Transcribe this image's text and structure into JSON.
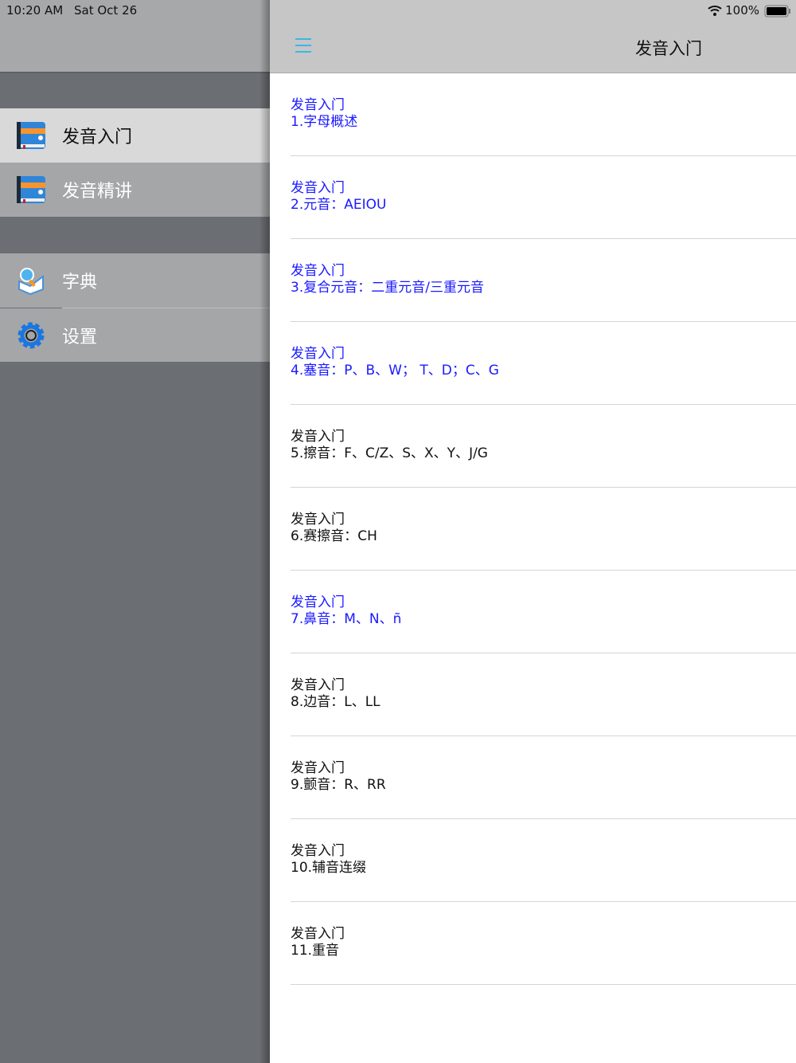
{
  "status": {
    "time": "10:20 AM",
    "date": "Sat Oct 26",
    "battery": "100%"
  },
  "sidebar": {
    "items": [
      {
        "label": "发音入门",
        "icon": "book-icon",
        "active": true
      },
      {
        "label": "发音精讲",
        "icon": "book-icon",
        "active": false
      },
      {
        "label": "字典",
        "icon": "dictionary-search-icon",
        "active": false
      },
      {
        "label": "设置",
        "icon": "gear-icon",
        "active": false
      }
    ]
  },
  "nav": {
    "title": "发音入门",
    "menu_icon": "hamburger-menu-icon",
    "accent": "#3fb4e6"
  },
  "list": [
    {
      "section": "发音入门",
      "title": "1.字母概述",
      "blue": true
    },
    {
      "section": "发音入门",
      "title": "2.元音：AEIOU",
      "blue": true
    },
    {
      "section": "发音入门",
      "title": "3.复合元音：二重元音/三重元音",
      "blue": true
    },
    {
      "section": "发音入门",
      "title": "4.塞音：P、B、W； T、D；C、G",
      "blue": true
    },
    {
      "section": "发音入门",
      "title": "5.擦音：F、C/Z、S、X、Y、J/G",
      "blue": false
    },
    {
      "section": "发音入门",
      "title": "6.赛擦音：CH",
      "blue": false
    },
    {
      "section": "发音入门",
      "title": "7.鼻音：M、N、ñ",
      "blue": true
    },
    {
      "section": "发音入门",
      "title": "8.边音：L、LL",
      "blue": false
    },
    {
      "section": "发音入门",
      "title": "9.颤音：R、RR",
      "blue": false
    },
    {
      "section": "发音入门",
      "title": "10.辅音连缀",
      "blue": false
    },
    {
      "section": "发音入门",
      "title": "11.重音",
      "blue": false
    }
  ],
  "colors": {
    "link": "#1a1aff"
  }
}
